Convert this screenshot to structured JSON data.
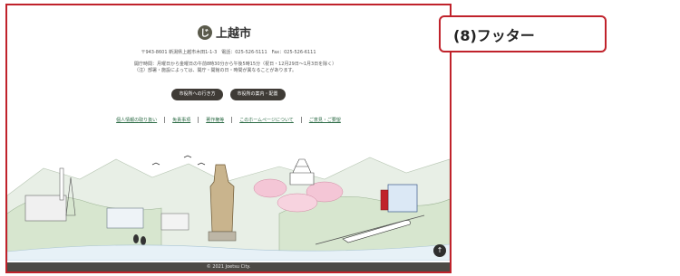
{
  "footer": {
    "logo_mark": "じ",
    "logo_text": "上越市",
    "address_line": "〒943-8601 新潟県上越市木田1-1-3　電話：025-526-5111　Fax：025-526-6111",
    "hours_line1": "開庁時間：月曜日から金曜日の午前8時30分から午後5時15分（祝日・12月29日～1月3日を除く）",
    "hours_line2": "（注）部署・施設によっては、開庁・開館の日・時間が異なることがあります。",
    "buttons": [
      "市役所への行き方",
      "市役所の案内・配置"
    ],
    "links": [
      "個人情報の取り扱い",
      "免責事項",
      "著作権等",
      "このホームページについて",
      "ご意見・ご要望"
    ],
    "back_to_top": "↑",
    "copyright": "© 2021 Joetsu City."
  },
  "callout": {
    "label": "(8)フッター"
  },
  "colors": {
    "frame_border": "#c0222b",
    "button_bg": "#3f3b36",
    "link": "#2c6b45",
    "copyright_bg": "#4d4a45"
  }
}
